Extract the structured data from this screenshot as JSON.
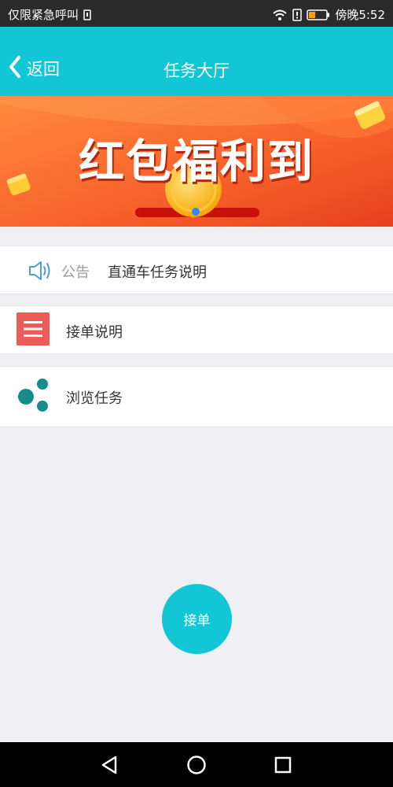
{
  "status_bar": {
    "carrier": "仅限紧急呼叫",
    "time": "傍晚5:52"
  },
  "header": {
    "back_label": "返回",
    "title": "任务大厅"
  },
  "banner": {
    "headline": "红包福利到"
  },
  "notice": {
    "label": "公告",
    "text": "直通车任务说明"
  },
  "menu": {
    "accept_instructions": "接单说明",
    "browse_tasks": "浏览任务"
  },
  "accept_button": "接单",
  "colors": {
    "primary": "#12c6d6",
    "accent_red": "#ef5b57",
    "share_teal": "#178c8c",
    "banner_orange": "#f7602a"
  }
}
